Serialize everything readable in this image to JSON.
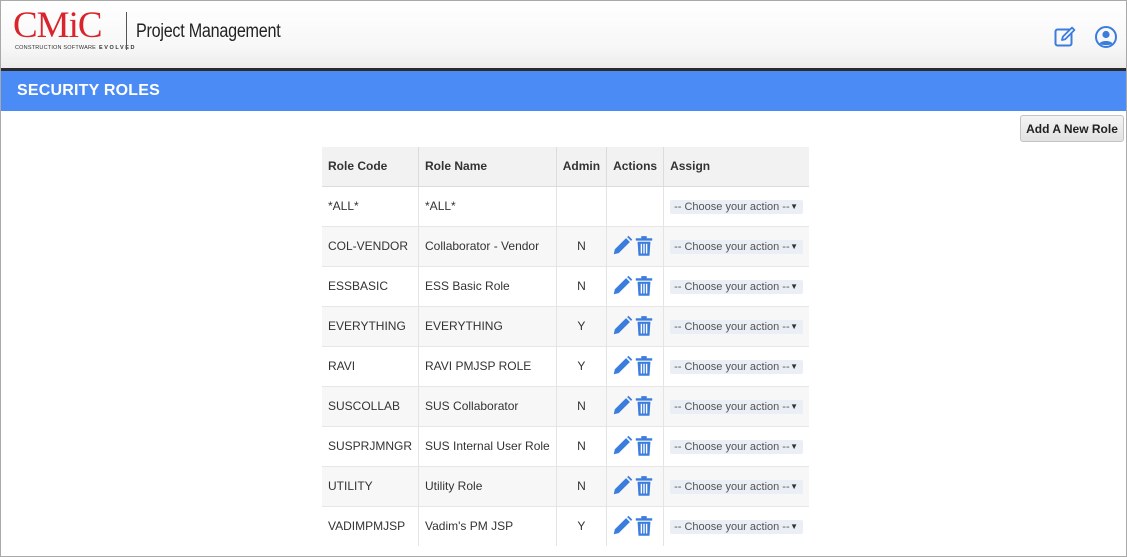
{
  "header": {
    "logo_main": "CMiC",
    "logo_sub": "CONSTRUCTION SOFTWARE",
    "logo_evolved": "EVOLVED",
    "app_title": "Project Management",
    "icons": [
      "edit-icon",
      "user-icon"
    ]
  },
  "titlebar": {
    "title": "SECURITY ROLES",
    "color": "#4a8bf5"
  },
  "toolbar": {
    "add_role_label": "Add A New Role"
  },
  "table": {
    "columns": [
      "Role Code",
      "Role Name",
      "Admin",
      "Actions",
      "Assign"
    ],
    "assign_placeholder": "-- Choose your action --",
    "rows": [
      {
        "code": "*ALL*",
        "name": "*ALL*",
        "admin": "",
        "actions": false
      },
      {
        "code": "COL-VENDOR",
        "name": "Collaborator - Vendor",
        "admin": "N",
        "actions": true
      },
      {
        "code": "ESSBASIC",
        "name": "ESS Basic Role",
        "admin": "N",
        "actions": true
      },
      {
        "code": "EVERYTHING",
        "name": "EVERYTHING",
        "admin": "Y",
        "actions": true
      },
      {
        "code": "RAVI",
        "name": "RAVI PMJSP ROLE",
        "admin": "Y",
        "actions": true
      },
      {
        "code": "SUSCOLLAB",
        "name": "SUS Collaborator",
        "admin": "N",
        "actions": true
      },
      {
        "code": "SUSPRJMNGR",
        "name": "SUS Internal User Role",
        "admin": "N",
        "actions": true
      },
      {
        "code": "UTILITY",
        "name": "Utility Role",
        "admin": "N",
        "actions": true
      },
      {
        "code": "VADIMPMJSP",
        "name": "Vadim's PM JSP",
        "admin": "Y",
        "actions": true
      }
    ]
  },
  "colors": {
    "accent": "#4a8bf5",
    "icon_blue": "#3b7ddd",
    "brand_red": "#d9242b"
  }
}
